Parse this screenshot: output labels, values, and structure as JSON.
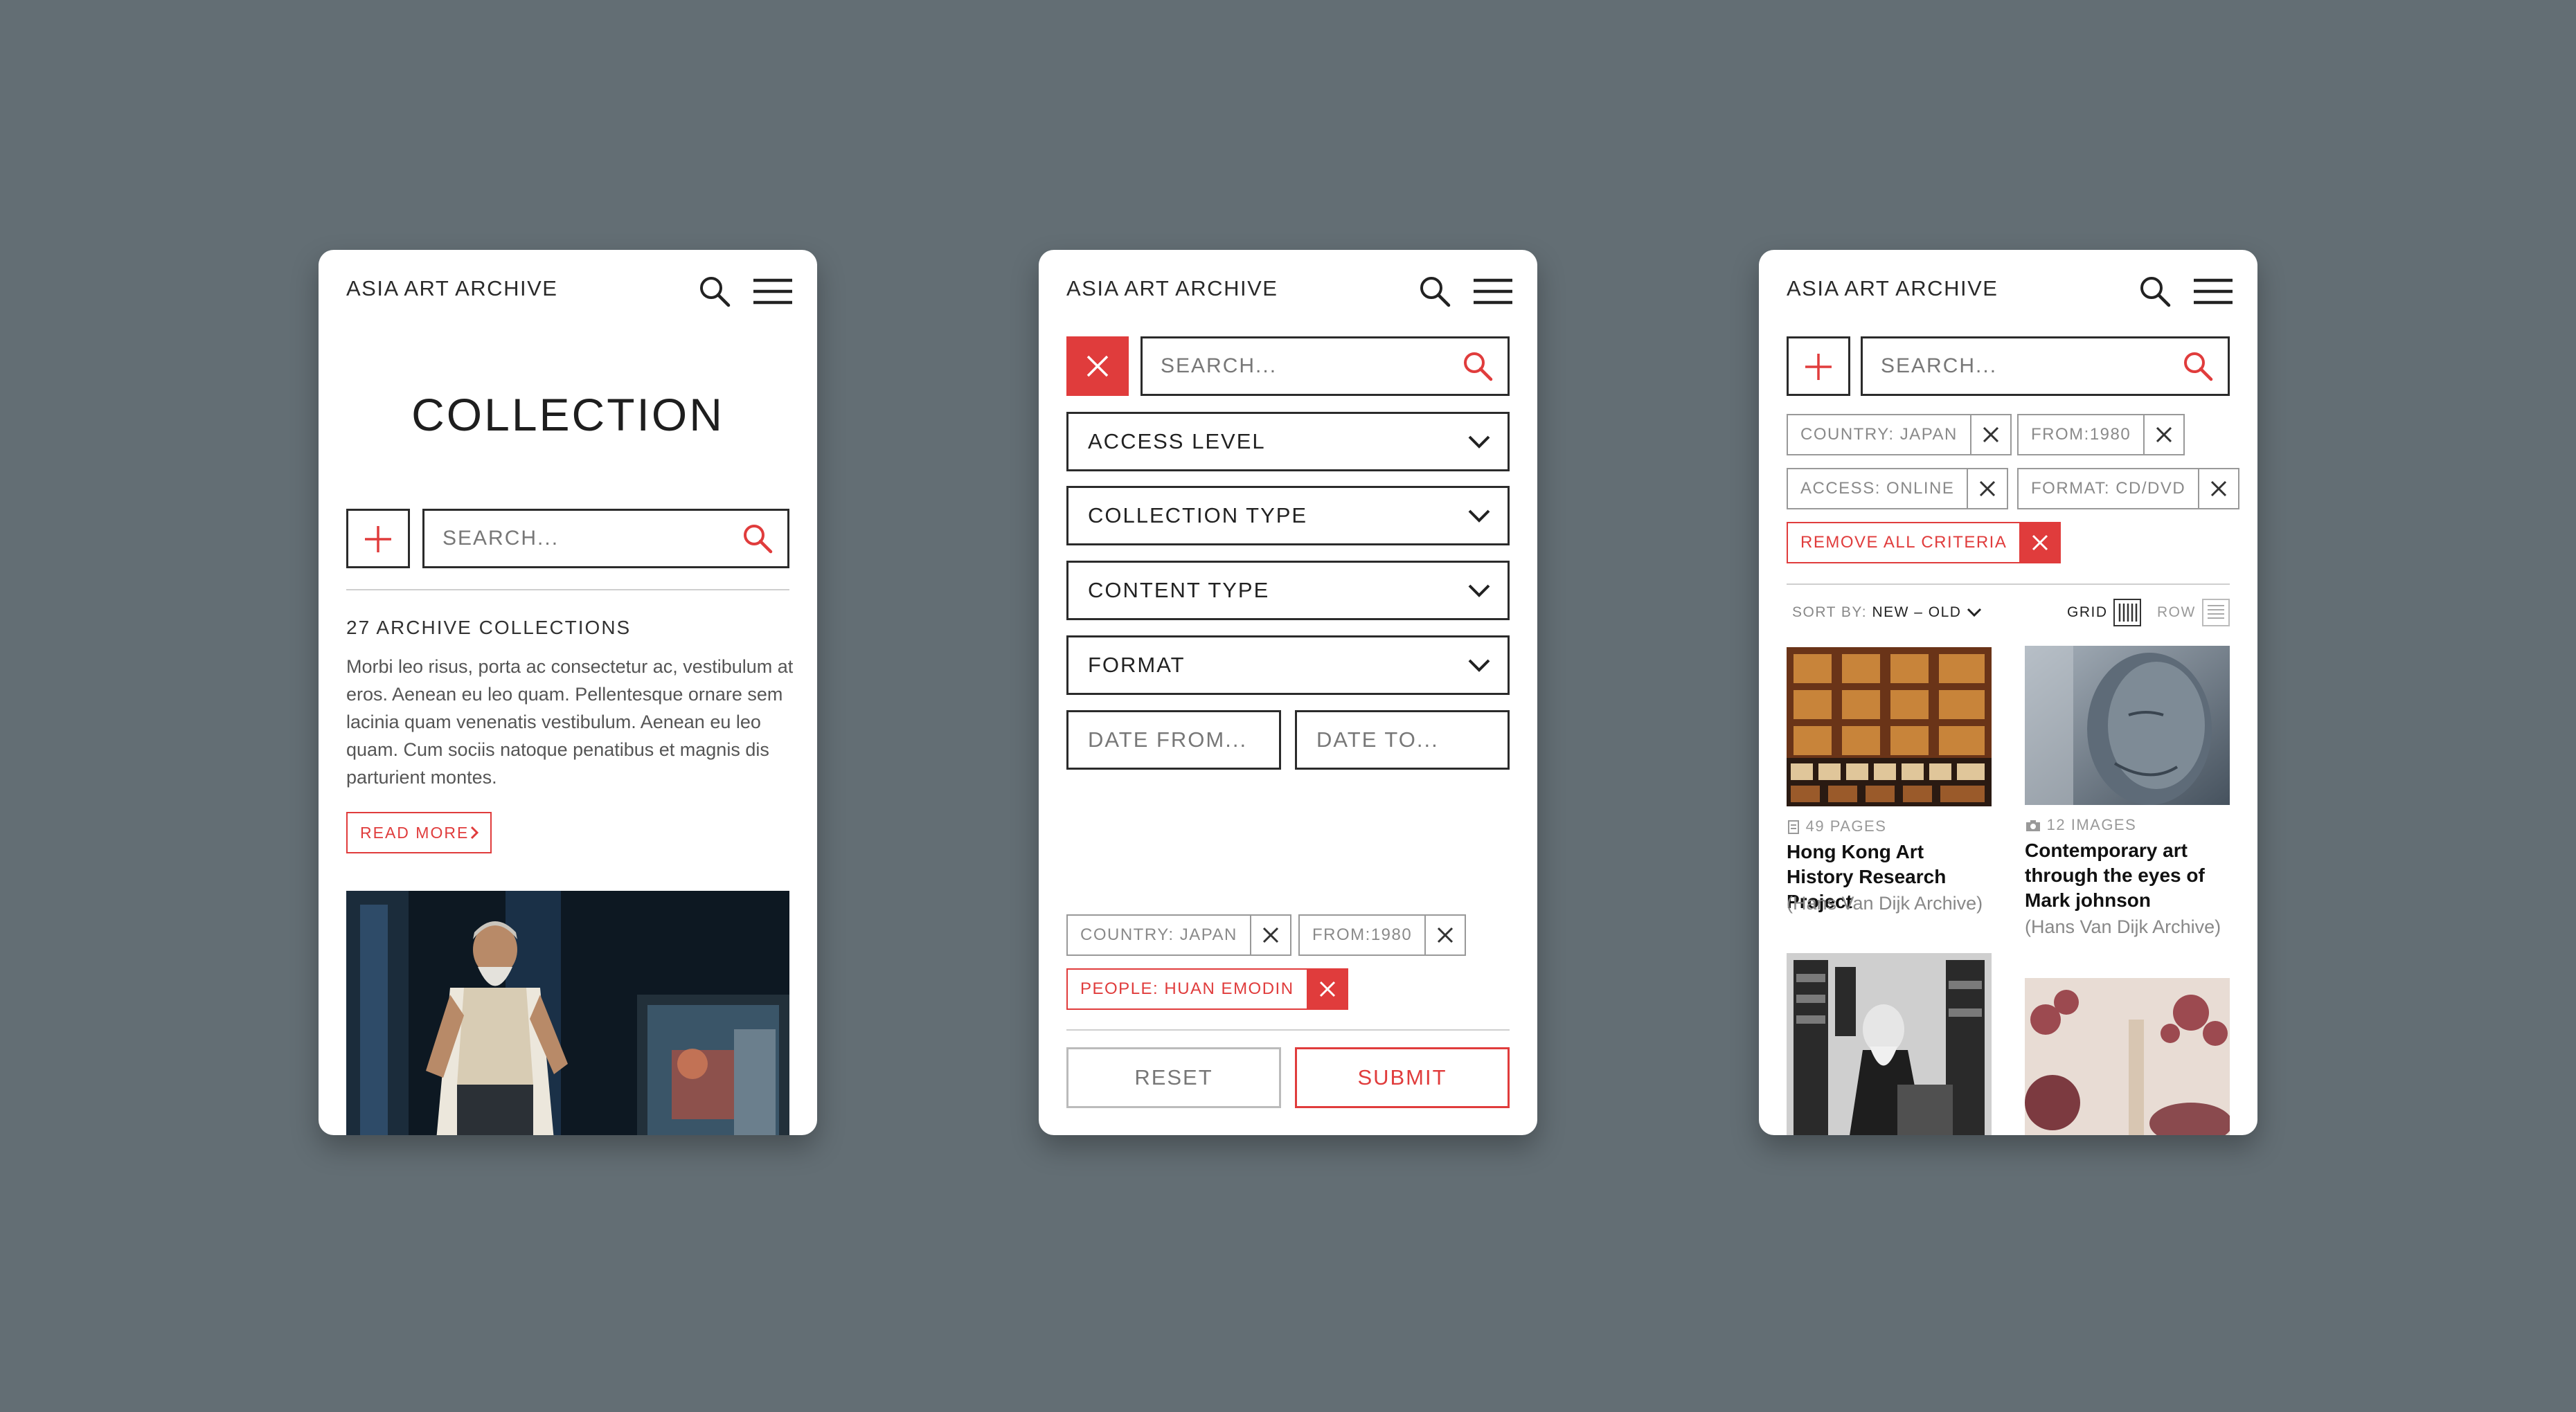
{
  "brand": "ASIA ART ARCHIVE",
  "colors": {
    "accent": "#e03c3c",
    "background": "#636e74",
    "text": "#222222"
  },
  "screen1": {
    "heading": "COLLECTION",
    "search_placeholder": "SEARCH...",
    "count": "27 ARCHIVE COLLECTIONS",
    "body": "Morbi leo risus, porta ac consectetur ac, vestibulum at eros. Aenean eu leo quam. Pellentesque ornare sem lacinia quam venenatis vestibulum. Aenean eu leo quam. Cum sociis natoque penatibus et magnis dis parturient montes.",
    "read_more": "READ MORE"
  },
  "screen2": {
    "search_placeholder": "SEARCH...",
    "filters": [
      "ACCESS LEVEL",
      "COLLECTION TYPE",
      "CONTENT TYPE",
      "FORMAT"
    ],
    "date_from": "DATE FROM...",
    "date_to": "DATE TO...",
    "chips": [
      "COUNTRY: JAPAN",
      "FROM:1980",
      "PEOPLE: HUAN EMODIN"
    ],
    "reset": "RESET",
    "submit": "SUBMIT"
  },
  "screen3": {
    "search_placeholder": "SEARCH...",
    "chips": [
      "COUNTRY: JAPAN",
      "FROM:1980",
      "ACCESS: ONLINE",
      "FORMAT: CD/DVD"
    ],
    "remove_all": "REMOVE ALL CRITERIA",
    "sort_label": "SORT BY:",
    "sort_value": "NEW – OLD",
    "view_grid": "GRID",
    "view_row": "ROW",
    "cards": [
      {
        "meta": "49 PAGES",
        "meta_icon": "document-icon",
        "title": "Hong Kong Art History Research Project",
        "source": "(Hans Van Dijk Archive)"
      },
      {
        "meta": "12 IMAGES",
        "meta_icon": "camera-icon",
        "title": "Contemporary art through the eyes of Mark johnson",
        "source": "(Hans Van Dijk Archive)"
      }
    ]
  }
}
